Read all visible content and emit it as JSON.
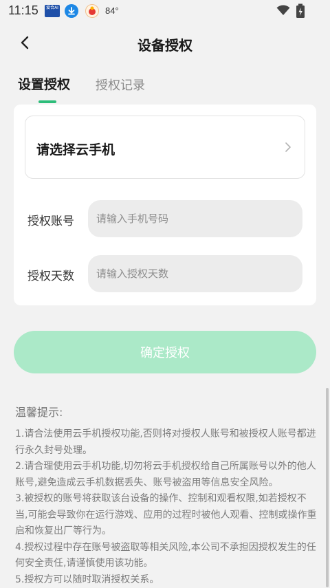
{
  "status_bar": {
    "time": "11:15",
    "app1_text": "爱合AI",
    "temperature": "84°"
  },
  "header": {
    "title": "设备授权"
  },
  "tabs": [
    {
      "label": "设置授权",
      "active": true
    },
    {
      "label": "授权记录",
      "active": false
    }
  ],
  "form": {
    "select_placeholder": "请选择云手机",
    "account_label": "授权账号",
    "account_placeholder": "请输入手机号码",
    "days_label": "授权天数",
    "days_placeholder": "请输入授权天数"
  },
  "confirm_button": "确定授权",
  "tips": {
    "title": "温馨提示:",
    "items": [
      "1.请合法使用云手机授权功能,否则将对授权人账号和被授权人账号都进行永久封号处理。",
      "2.请合理使用云手机功能,切勿将云手机授权给自己所属账号以外的他人账号,避免造成云手机数据丢失、账号被盗用等信息安全风险。",
      "3.被授权的账号将获取该台设备的操作、控制和观看权限,如若授权不当,可能会导致你在运行游戏、应用的过程时被他人观看、控制或操作重启和恢复出厂等行为。",
      "4.授权过程中存在账号被盗取等相关风险,本公司不承担因授权发生的任何安全责任,请谨慎使用该功能。",
      "5.授权方可以随时取消授权关系。"
    ]
  },
  "colors": {
    "accent": "#2dbd7a",
    "button_disabled": "#abe9c8",
    "background": "#f2f2f2"
  },
  "icons": {
    "back": "chevron-left-icon",
    "select_arrow": "chevron-right-icon",
    "wifi": "wifi-icon",
    "battery": "battery-icon"
  }
}
